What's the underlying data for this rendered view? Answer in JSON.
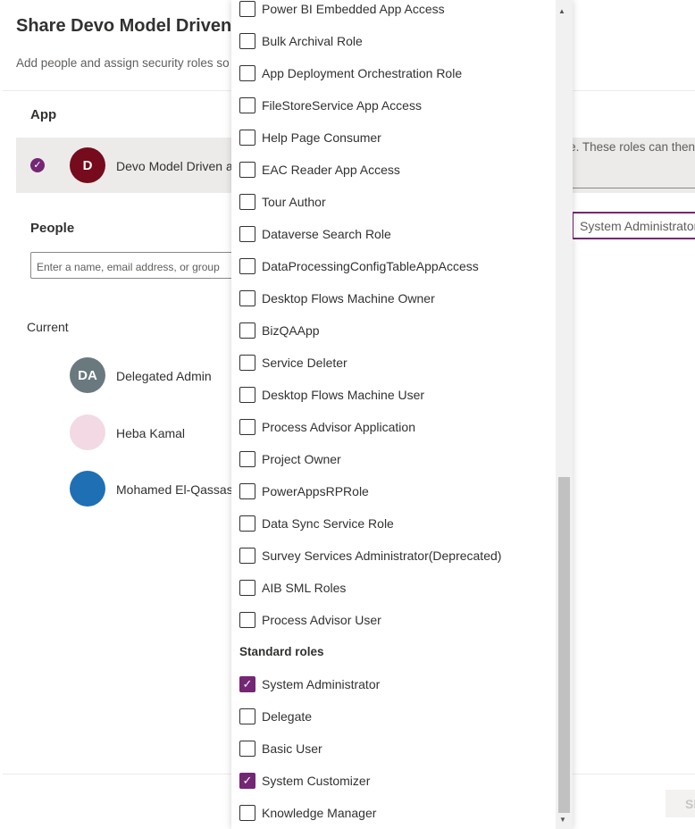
{
  "dialog": {
    "title": "Share Devo Model Driven app",
    "subtitle": "Add people and assign security roles so they can use the app. These roles can then",
    "app_label": "App",
    "app_name": "Devo Model Driven app",
    "app_initial": "D",
    "people_label": "People",
    "people_placeholder": "Enter a name, email address, or group",
    "current_label": "Current",
    "role_input_value": "System Administrator",
    "share_button": "Share"
  },
  "people": [
    {
      "initials": "DA",
      "name": "Delegated Admin",
      "color": "#69797e"
    },
    {
      "initials": "",
      "name": "Heba Kamal",
      "color": "#f3d9e3"
    },
    {
      "initials": "",
      "name": "Mohamed El-Qassas",
      "color": "#1f6fb5"
    }
  ],
  "roles": [
    {
      "label": "Power BI Embedded App Access",
      "checked": false
    },
    {
      "label": "Bulk Archival Role",
      "checked": false
    },
    {
      "label": "App Deployment Orchestration Role",
      "checked": false
    },
    {
      "label": "FileStoreService App Access",
      "checked": false
    },
    {
      "label": "Help Page Consumer",
      "checked": false
    },
    {
      "label": "EAC Reader App Access",
      "checked": false
    },
    {
      "label": "Tour Author",
      "checked": false
    },
    {
      "label": "Dataverse Search Role",
      "checked": false
    },
    {
      "label": "DataProcessingConfigTableAppAccess",
      "checked": false
    },
    {
      "label": "Desktop Flows Machine Owner",
      "checked": false
    },
    {
      "label": "BizQAApp",
      "checked": false
    },
    {
      "label": "Service Deleter",
      "checked": false
    },
    {
      "label": "Desktop Flows Machine User",
      "checked": false
    },
    {
      "label": "Process Advisor Application",
      "checked": false
    },
    {
      "label": "Project Owner",
      "checked": false
    },
    {
      "label": "PowerAppsRPRole",
      "checked": false
    },
    {
      "label": "Data Sync Service Role",
      "checked": false
    },
    {
      "label": "Survey Services Administrator(Deprecated)",
      "checked": false
    },
    {
      "label": "AIB SML Roles",
      "checked": false
    },
    {
      "label": "Process Advisor User",
      "checked": false
    }
  ],
  "standard_group": "Standard roles",
  "standard_roles": [
    {
      "label": "System Administrator",
      "checked": true
    },
    {
      "label": "Delegate",
      "checked": false
    },
    {
      "label": "Basic User",
      "checked": false
    },
    {
      "label": "System Customizer",
      "checked": true
    },
    {
      "label": "Knowledge Manager",
      "checked": false
    }
  ],
  "colors": {
    "accent": "#742774",
    "app_avatar": "#750b1c"
  }
}
